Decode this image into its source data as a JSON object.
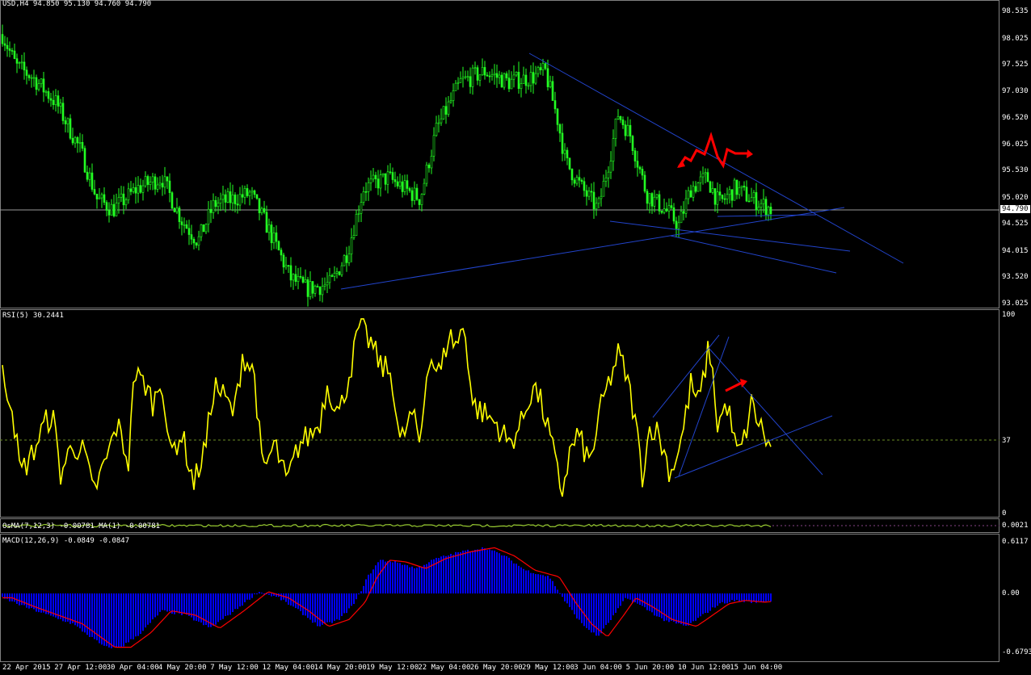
{
  "main": {
    "header": "USD,H4  94.850 95.130 94.760 94.790",
    "current_price_tag": "94.790",
    "price_ticks": [
      "98.535",
      "98.025",
      "97.525",
      "97.030",
      "96.520",
      "96.025",
      "95.530",
      "95.020",
      "94.525",
      "94.015",
      "93.520",
      "93.025"
    ]
  },
  "rsi": {
    "header": "RSI(5) 30.2441",
    "ticks": [
      "100",
      "37",
      "0"
    ]
  },
  "osma": {
    "header": "OsMA(7,12,3) -0.00781  MA(1) -0.00781",
    "tick": "0.0021"
  },
  "macd": {
    "header": "MACD(12,26,9) -0.0849 -0.0847",
    "ticks": [
      "0.6117",
      "0.00",
      "-0.6793"
    ]
  },
  "time_axis": [
    "22 Apr 2015",
    "27 Apr 12:00",
    "30 Apr 04:00",
    "4 May 20:00",
    "7 May 12:00",
    "12 May 04:00",
    "14 May 20:00",
    "19 May 12:00",
    "22 May 04:00",
    "26 May 20:00",
    "29 May 12:00",
    "3 Jun 04:00",
    "5 Jun 20:00",
    "10 Jun 12:00",
    "15 Jun 04:00"
  ],
  "colors": {
    "candles": "#22ff22",
    "rsi_line": "#ffff00",
    "macd_histogram": "#0000ff",
    "macd_signal": "#ff0000",
    "trendlines": "#2244cc",
    "annotations": "#ff0000",
    "osma_line": "#9acd32"
  },
  "chart_data": [
    {
      "type": "candlestick",
      "title": "USD,H4",
      "ohlc_last": {
        "open": 94.85,
        "high": 95.13,
        "low": 94.76,
        "close": 94.79
      },
      "ylim": [
        93.025,
        98.535
      ],
      "x": [
        "22 Apr 2015",
        "27 Apr 12:00",
        "30 Apr 04:00",
        "4 May 20:00",
        "7 May 12:00",
        "12 May 04:00",
        "14 May 20:00",
        "19 May 12:00",
        "22 May 04:00",
        "26 May 20:00",
        "29 May 12:00",
        "3 Jun 04:00",
        "5 Jun 20:00",
        "10 Jun 12:00",
        "15 Jun 04:00"
      ],
      "close_approx": [
        98.1,
        97.0,
        95.0,
        94.8,
        95.1,
        94.9,
        93.3,
        95.5,
        96.3,
        97.4,
        97.3,
        95.5,
        96.5,
        94.9,
        94.8
      ]
    },
    {
      "type": "line",
      "title": "RSI(5)",
      "last_value": 30.2441,
      "ylim": [
        0,
        100
      ],
      "level": 37,
      "x": [
        "22 Apr 2015",
        "27 Apr 12:00",
        "30 Apr 04:00",
        "4 May 20:00",
        "7 May 12:00",
        "12 May 04:00",
        "14 May 20:00",
        "19 May 12:00",
        "22 May 04:00",
        "26 May 20:00",
        "29 May 12:00",
        "3 Jun 04:00",
        "5 Jun 20:00",
        "10 Jun 12:00",
        "15 Jun 04:00"
      ],
      "values": [
        60,
        30,
        20,
        60,
        35,
        75,
        25,
        90,
        55,
        95,
        40,
        20,
        80,
        75,
        30
      ]
    },
    {
      "type": "line",
      "title": "OsMA(7,12,3)",
      "last_value": -0.00781,
      "ma_last_value": -0.00781
    },
    {
      "type": "bar",
      "title": "MACD(12,26,9)",
      "main_last": -0.0849,
      "signal_last": -0.0847,
      "ylim": [
        -0.6793,
        0.6117
      ],
      "x": [
        "22 Apr 2015",
        "27 Apr 12:00",
        "30 Apr 04:00",
        "4 May 20:00",
        "7 May 12:00",
        "12 May 04:00",
        "14 May 20:00",
        "19 May 12:00",
        "22 May 04:00",
        "26 May 20:00",
        "29 May 12:00",
        "3 Jun 04:00",
        "5 Jun 20:00",
        "10 Jun 12:00",
        "15 Jun 04:00"
      ],
      "values": [
        -0.1,
        -0.3,
        -0.6,
        -0.2,
        -0.35,
        0.05,
        -0.35,
        0.4,
        0.35,
        0.55,
        0.2,
        -0.4,
        -0.1,
        -0.2,
        -0.08
      ]
    }
  ]
}
